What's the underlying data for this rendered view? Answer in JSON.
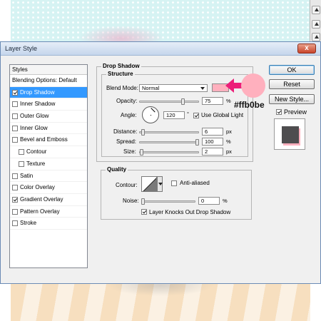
{
  "window": {
    "title": "Layer Style",
    "close_label": "x"
  },
  "styles_panel": {
    "header": "Styles",
    "items": [
      {
        "label": "Blending Options: Default",
        "checkbox": false,
        "checked": false,
        "selected": false,
        "indent": false
      },
      {
        "label": "Drop Shadow",
        "checkbox": true,
        "checked": true,
        "selected": true,
        "indent": false
      },
      {
        "label": "Inner Shadow",
        "checkbox": true,
        "checked": false,
        "selected": false,
        "indent": false
      },
      {
        "label": "Outer Glow",
        "checkbox": true,
        "checked": false,
        "selected": false,
        "indent": false
      },
      {
        "label": "Inner Glow",
        "checkbox": true,
        "checked": false,
        "selected": false,
        "indent": false
      },
      {
        "label": "Bevel and Emboss",
        "checkbox": true,
        "checked": false,
        "selected": false,
        "indent": false
      },
      {
        "label": "Contour",
        "checkbox": true,
        "checked": false,
        "selected": false,
        "indent": true
      },
      {
        "label": "Texture",
        "checkbox": true,
        "checked": false,
        "selected": false,
        "indent": true
      },
      {
        "label": "Satin",
        "checkbox": true,
        "checked": false,
        "selected": false,
        "indent": false
      },
      {
        "label": "Color Overlay",
        "checkbox": true,
        "checked": false,
        "selected": false,
        "indent": false
      },
      {
        "label": "Gradient Overlay",
        "checkbox": true,
        "checked": true,
        "selected": false,
        "indent": false
      },
      {
        "label": "Pattern Overlay",
        "checkbox": true,
        "checked": false,
        "selected": false,
        "indent": false
      },
      {
        "label": "Stroke",
        "checkbox": true,
        "checked": false,
        "selected": false,
        "indent": false
      }
    ]
  },
  "drop_shadow": {
    "group_title": "Drop Shadow",
    "structure_title": "Structure",
    "blend_mode": {
      "label": "Blend Mode:",
      "value": "Normal",
      "swatch_color": "#ffb0be"
    },
    "opacity": {
      "label": "Opacity:",
      "value": "75",
      "unit": "%",
      "level": 75
    },
    "angle": {
      "label": "Angle:",
      "value": "120",
      "unit": "°",
      "global_light_label": "Use Global Light",
      "global_light": true
    },
    "distance": {
      "label": "Distance:",
      "value": "6",
      "unit": "px",
      "level": 0.04
    },
    "spread": {
      "label": "Spread:",
      "value": "100",
      "unit": "%",
      "level": 100
    },
    "size": {
      "label": "Size:",
      "value": "2",
      "unit": "px",
      "level": 0.01
    }
  },
  "quality": {
    "title": "Quality",
    "contour_label": "Contour:",
    "anti_aliased_label": "Anti-aliased",
    "anti_aliased": false,
    "noise": {
      "label": "Noise:",
      "value": "0",
      "unit": "%",
      "level": 0
    },
    "knocks_out_label": "Layer Knocks Out Drop Shadow",
    "knocks_out": true
  },
  "buttons": {
    "ok": "OK",
    "reset": "Reset",
    "new_style": "New Style...",
    "preview_label": "Preview",
    "preview": true
  },
  "annotation": {
    "color_text": "#ffb0be",
    "color": "#ffb0be",
    "arrow_color": "#ec1e79"
  }
}
